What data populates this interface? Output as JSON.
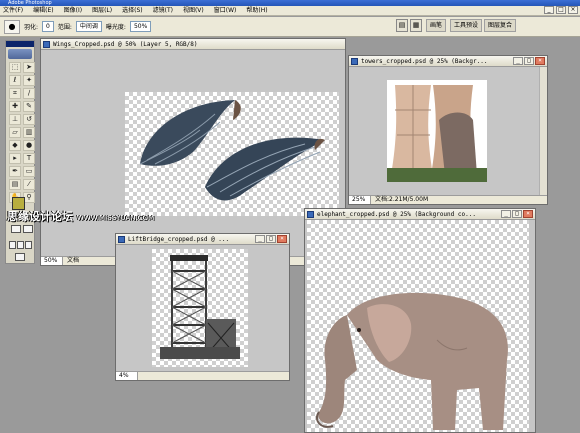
{
  "app": {
    "title": "Adobe Photoshop"
  },
  "menu": [
    "文件(F)",
    "编辑(E)",
    "图像(I)",
    "图层(L)",
    "选择(S)",
    "滤镜(T)",
    "视图(V)",
    "窗口(W)",
    "帮助(H)"
  ],
  "options": {
    "feather_label": "羽化:",
    "feather_value": "0",
    "range_label": "范围:",
    "range_value": "中间调",
    "exposure_label": "曝光度:",
    "exposure_value": "50%",
    "palette_tabs": [
      "画笔",
      "工具预设",
      "图层复合"
    ]
  },
  "documents": {
    "wings": {
      "title": "Wings_Cropped.psd @ 50% (Layer 5, RGB/8)",
      "zoom": "50%",
      "status": "文档"
    },
    "towers": {
      "title": "towers_cropped.psd @ 25% (Backgr...",
      "zoom": "25%",
      "status": "文档:2.21M/5.00M"
    },
    "liftbridge": {
      "title": "LiftBridge_cropped.psd @ ...",
      "zoom": "4%",
      "status": ""
    },
    "elephant": {
      "title": "elephant_cropped.psd @ 25% (Background co...",
      "zoom": "",
      "status": ""
    }
  },
  "watermark": {
    "text": "思缘设计论坛",
    "url": "WWW.MISSYUAN.COM"
  },
  "colors": {
    "foreground": "#b8ae3e",
    "background": "#ffffff",
    "accent": "#2456b8"
  }
}
